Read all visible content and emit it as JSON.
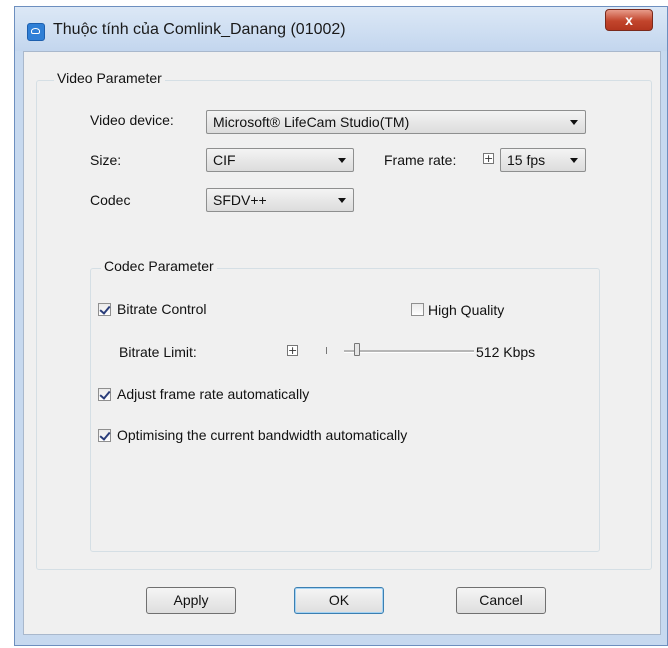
{
  "window": {
    "title": "Thuộc tính của Comlink_Danang (01002)",
    "close_label": "x"
  },
  "video": {
    "group_label": "Video Parameter",
    "device_label": "Video device:",
    "device_value": "Microsoft® LifeCam Studio(TM)",
    "size_label": "Size:",
    "size_value": "CIF",
    "frame_rate_label": "Frame rate:",
    "frame_rate_value": "15 fps",
    "codec_label": "Codec",
    "codec_value": "SFDV++"
  },
  "codec": {
    "group_label": "Codec Parameter",
    "bitrate_control_label": "Bitrate Control",
    "bitrate_control_checked": true,
    "high_quality_label": "High Quality",
    "high_quality_checked": false,
    "bitrate_limit_label": "Bitrate Limit:",
    "bitrate_limit_value": "512 Kbps",
    "adjust_frame_rate_label": "Adjust frame rate automatically",
    "adjust_frame_rate_checked": true,
    "optimise_label": "Optimising the current bandwidth automatically",
    "optimise_checked": true
  },
  "buttons": {
    "apply": "Apply",
    "ok": "OK",
    "cancel": "Cancel"
  },
  "icons": {
    "title": "camera-app-icon",
    "expand": "plus-box-icon"
  }
}
